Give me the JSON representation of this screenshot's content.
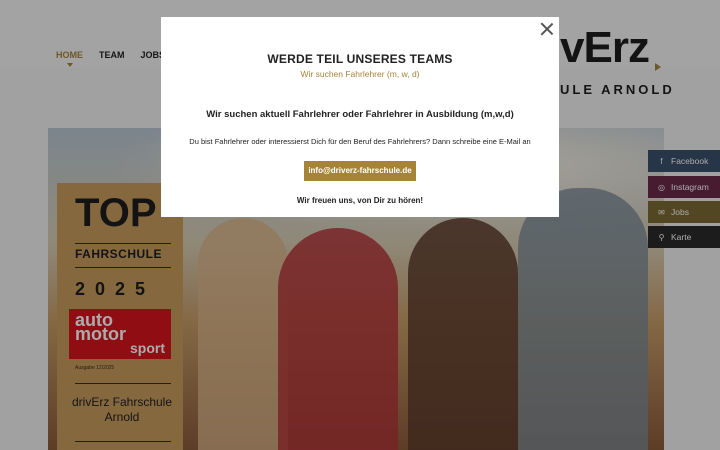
{
  "nav": {
    "items": [
      {
        "label": "HOME"
      },
      {
        "label": "TEAM"
      },
      {
        "label": "JOBS"
      }
    ]
  },
  "logo": {
    "main": "vErz",
    "sub": "ULE ARNOLD"
  },
  "award": {
    "top": "TOP",
    "category": "FAHRSCHULE",
    "year": "2025",
    "magazine_line1": "auto",
    "magazine_line2": "motor",
    "magazine_line3": "sport",
    "edition": "Ausgabe 12/2025",
    "name": "drivErz Fahrschule Arnold"
  },
  "side_links": [
    {
      "label": "Facebook",
      "icon": "facebook-icon",
      "color": "#3a4f6a"
    },
    {
      "label": "Instagram",
      "icon": "instagram-icon",
      "color": "#6b2a4a"
    },
    {
      "label": "Jobs",
      "icon": "mail-icon",
      "color": "#7d6a35"
    },
    {
      "label": "Karte",
      "icon": "map-pin-icon",
      "color": "#2a2a2a"
    }
  ],
  "modal": {
    "title": "WERDE TEIL UNSERES TEAMS",
    "subtitle": "Wir suchen Fahrlehrer (m, w, d)",
    "heading": "Wir suchen aktuell Fahrlehrer oder Fahrlehrer in Ausbildung (m,w,d)",
    "text": "Du bist Fahrlehrer oder interessierst Dich für den Beruf des Fahrlehrers? Dann schreibe eine E-Mail an",
    "email": "info@driverz-fahrschule.de",
    "thanks": "Wir freuen uns, von Dir zu hören!"
  },
  "colors": {
    "accent": "#a5843a"
  }
}
